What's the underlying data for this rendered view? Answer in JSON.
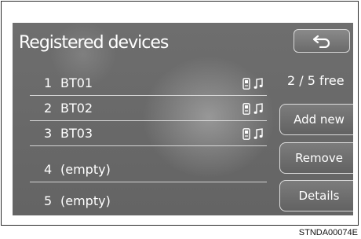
{
  "screen": {
    "title": "Registered devices",
    "free_status": "2 / 5 free"
  },
  "devices": [
    {
      "number": "1",
      "name": "BT01",
      "icons": [
        "phone-icon",
        "music-icon"
      ]
    },
    {
      "number": "2",
      "name": "BT02",
      "icons": [
        "phone-icon",
        "music-icon"
      ]
    },
    {
      "number": "3",
      "name": "BT03",
      "icons": [
        "phone-icon",
        "music-icon"
      ]
    },
    {
      "number": "4",
      "name": "(empty)",
      "icons": []
    },
    {
      "number": "5",
      "name": "(empty)",
      "icons": []
    }
  ],
  "buttons": {
    "back_icon": "return-arrow-icon",
    "add_new": "Add new",
    "remove": "Remove",
    "details": "Details"
  },
  "caption": "STNDA00074E",
  "colors": {
    "screen_background": "#666666",
    "text": "#ffffff",
    "button_border": "#dcdcdc"
  }
}
